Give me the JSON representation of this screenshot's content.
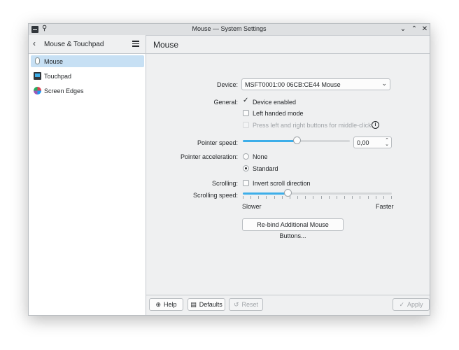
{
  "window": {
    "title": "Mouse — System Settings",
    "app_icon": "system-settings-icon",
    "pin_icon": "pin-icon"
  },
  "sidebar": {
    "title": "Mouse & Touchpad",
    "items": [
      {
        "label": "Mouse",
        "icon": "mouse-icon",
        "selected": true
      },
      {
        "label": "Touchpad",
        "icon": "touchpad-icon",
        "selected": false
      },
      {
        "label": "Screen Edges",
        "icon": "screen-edges-icon",
        "selected": false
      }
    ]
  },
  "page": {
    "title": "Mouse",
    "device": {
      "label": "Device:",
      "value": "MSFT0001:00 06CB:CE44 Mouse"
    },
    "general": {
      "label": "General:",
      "options": [
        {
          "label": "Device enabled",
          "checked": true,
          "disabled": false
        },
        {
          "label": "Left handed mode",
          "checked": false,
          "disabled": false
        },
        {
          "label": "Press left and right buttons for middle-click",
          "checked": false,
          "disabled": true
        }
      ]
    },
    "pointer_speed": {
      "label": "Pointer speed:",
      "value": "0,00",
      "level": 0.5
    },
    "pointer_acceleration": {
      "label": "Pointer acceleration:",
      "options": [
        {
          "label": "None",
          "checked": false
        },
        {
          "label": "Standard",
          "checked": true
        }
      ]
    },
    "scrolling": {
      "label": "Scrolling:",
      "invert_label": "Invert scroll direction",
      "invert_checked": false
    },
    "scrolling_speed": {
      "label": "Scrolling speed:",
      "slower": "Slower",
      "faster": "Faster",
      "level": 0.3
    },
    "rebind_button": "Re-bind Additional Mouse Buttons..."
  },
  "footer": {
    "help": "Help",
    "defaults": "Defaults",
    "reset": "Reset",
    "apply": "Apply"
  },
  "colors": {
    "accent": "#3daee9",
    "selection": "#c7e0f4"
  }
}
